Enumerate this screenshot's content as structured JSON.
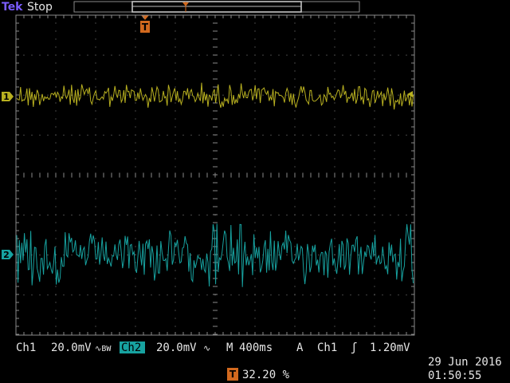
{
  "header": {
    "brand": "Tek",
    "status": "Stop"
  },
  "trigger_marker": "T",
  "channels": [
    {
      "id": "1",
      "color": "#b8b020"
    },
    {
      "id": "2",
      "color": "#17a2a0"
    }
  ],
  "status_bar": {
    "ch1_label": "Ch1",
    "ch1_scale": "20.0mV",
    "ch1_coupling": "∿BW",
    "ch2_label": "Ch2",
    "ch2_scale": "20.0mV",
    "ch2_coupling": "∿",
    "timebase_prefix": "M",
    "timebase": "400ms",
    "trigger_mode": "A",
    "trigger_source": "Ch1",
    "trigger_slope": "ʃ",
    "trigger_level": "1.20mV",
    "trigger_position": "32.20 %",
    "date": "29 Jun  2016",
    "time": "01:50:55"
  },
  "colors": {
    "accent": "#d2691e",
    "text": "#e6e6e6",
    "ch1": "#b8b020",
    "ch2": "#17a2a0",
    "graticule": "#8a8a8a"
  }
}
